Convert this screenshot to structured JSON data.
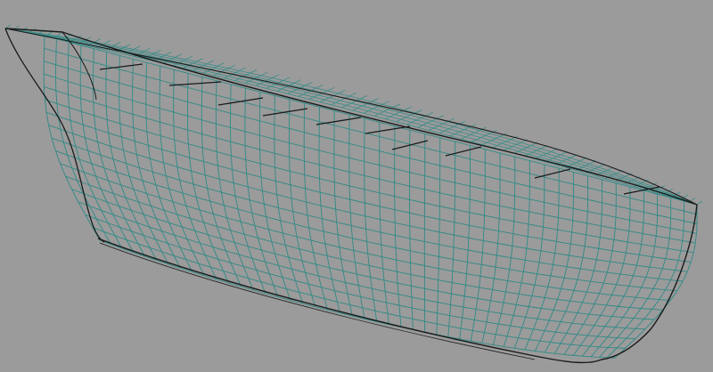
{
  "viewport": {
    "object": "ship-hull-wireframe",
    "background_color": "#9b9b9b",
    "mesh_color": "#2f8a86",
    "outline_color": "#1a1a1a",
    "deck_mesh_color": "#3a8c88"
  }
}
